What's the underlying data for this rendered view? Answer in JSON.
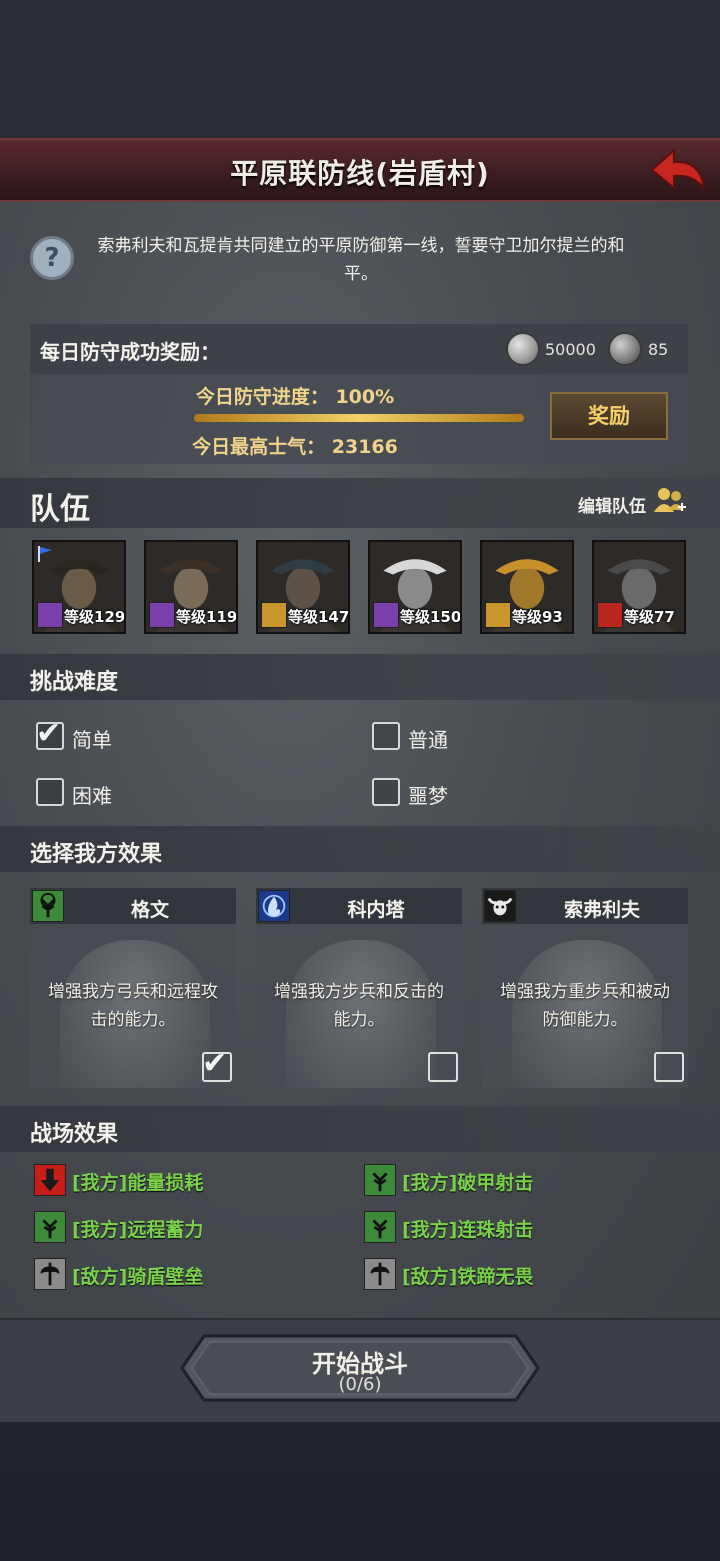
{
  "header": {
    "title": "平原联防线(岩盾村)"
  },
  "description": "索弗利夫和瓦提肯共同建立的平原防御第一线，誓要守卫加尔提兰的和平。",
  "reward": {
    "title": "每日防守成功奖励：",
    "currency1_value": "50000",
    "currency2_value": "85",
    "progress_text": "今日防守进度：  100%",
    "progress_fraction": 1.0,
    "morale_text": "今日最高士气：  23166",
    "button_label": "奖励"
  },
  "team": {
    "title": "队伍",
    "edit_label": "编辑队伍",
    "heroes": [
      {
        "level": "等级129",
        "class_icon": "staff-icon"
      },
      {
        "level": "等级119",
        "class_icon": "staff-icon"
      },
      {
        "level": "等级147",
        "class_icon": "shield-icon"
      },
      {
        "level": "等级150",
        "class_icon": "staff-icon"
      },
      {
        "level": "等级93",
        "class_icon": "shield-icon"
      },
      {
        "level": "等级77",
        "class_icon": "horse-icon"
      }
    ]
  },
  "difficulty": {
    "title": "挑战难度",
    "options": [
      {
        "label": "简单",
        "checked": true
      },
      {
        "label": "普通",
        "checked": false
      },
      {
        "label": "困难",
        "checked": false
      },
      {
        "label": "噩梦",
        "checked": false
      }
    ]
  },
  "effects": {
    "title": "选择我方效果",
    "cards": [
      {
        "name": "格文",
        "desc": "增强我方弓兵和远程攻击的能力。",
        "checked": true,
        "icon": "tree-icon"
      },
      {
        "name": "科内塔",
        "desc": "增强我方步兵和反击的能力。",
        "checked": false,
        "icon": "flame-icon"
      },
      {
        "name": "索弗利夫",
        "desc": "增强我方重步兵和被动防御能力。",
        "checked": false,
        "icon": "bull-skull-icon"
      }
    ]
  },
  "battlefield": {
    "title": "战场效果",
    "items": [
      {
        "label": "[我方]能量损耗",
        "icon": "down-arrow-icon"
      },
      {
        "label": "[我方]破甲射击",
        "icon": "tree-icon"
      },
      {
        "label": "[我方]远程蓄力",
        "icon": "tree-icon"
      },
      {
        "label": "[我方]连珠射击",
        "icon": "tree-icon"
      },
      {
        "label": "[敌方]骑盾壁垒",
        "icon": "axe-icon"
      },
      {
        "label": "[敌方]铁蹄无畏",
        "icon": "axe-icon"
      }
    ]
  },
  "start": {
    "label": "开始战斗",
    "count": "(0/6)"
  },
  "colors": {
    "accent_gold": "#f6cf6a",
    "effect_green": "#7ad14a",
    "header_red": "#5a2a2e"
  }
}
